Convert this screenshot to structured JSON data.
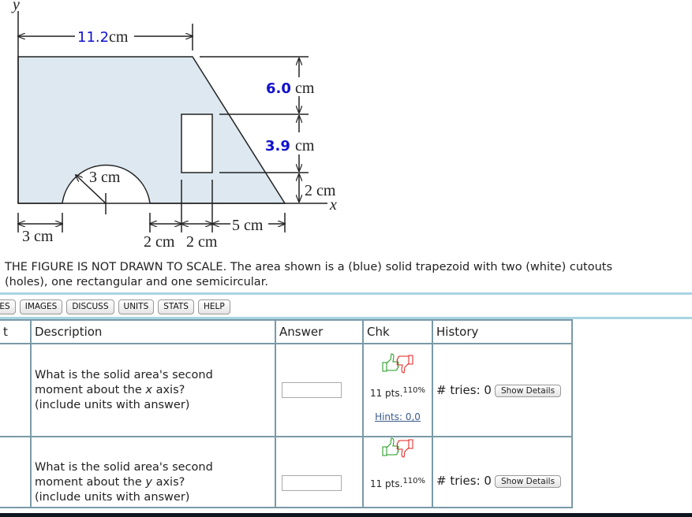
{
  "figure": {
    "axis_y": "y",
    "axis_x": "x",
    "top_width_value": "11.2",
    "top_width_unit": "cm",
    "dim_upper_value": "6.0",
    "dim_upper_unit": "cm",
    "dim_middle_value": "3.9",
    "dim_middle_unit": "cm",
    "dim_lower": "2 cm",
    "radius": "3 cm",
    "left_offset": "3 cm",
    "gap_1": "2 cm",
    "gap_2": "2 cm",
    "right_offset": "5 cm",
    "colors": {
      "fill": "#dde8f0",
      "highlight": "#1010d0",
      "line": "#222222"
    }
  },
  "caption": {
    "line1": "THE FIGURE IS NOT DRAWN TO SCALE. The area shown is a (blue) solid trapezoid with two (white) cutouts",
    "line2": "(holes), one rectangular and one semicircular."
  },
  "toolbar": [
    "TES",
    "IMAGES",
    "DISCUSS",
    "UNITS",
    "STATS",
    "HELP"
  ],
  "table": {
    "headers": [
      "t",
      "Description",
      "Answer",
      "Chk",
      "History"
    ],
    "rows": [
      {
        "q1": "What is the solid area's second",
        "q2a": "moment about the ",
        "axis": "x",
        "q2b": " axis?",
        "q3": "(include units with answer)",
        "answer": "",
        "pts": "11 pts.",
        "pct": "110%",
        "hints": "Hints: 0,0",
        "tries": "# tries: 0",
        "details": "Show Details"
      },
      {
        "q1": "What is the solid area's second",
        "q2a": "moment about the ",
        "axis": "y",
        "q2b": " axis?",
        "q3": "(include units with answer)",
        "answer": "",
        "pts": "11 pts.",
        "pct": "110%",
        "tries": "# tries: 0",
        "details": "Show Details"
      }
    ]
  },
  "icons": {
    "thumbs_up": "thumbs-up-icon",
    "thumbs_down": "thumbs-down-icon"
  }
}
